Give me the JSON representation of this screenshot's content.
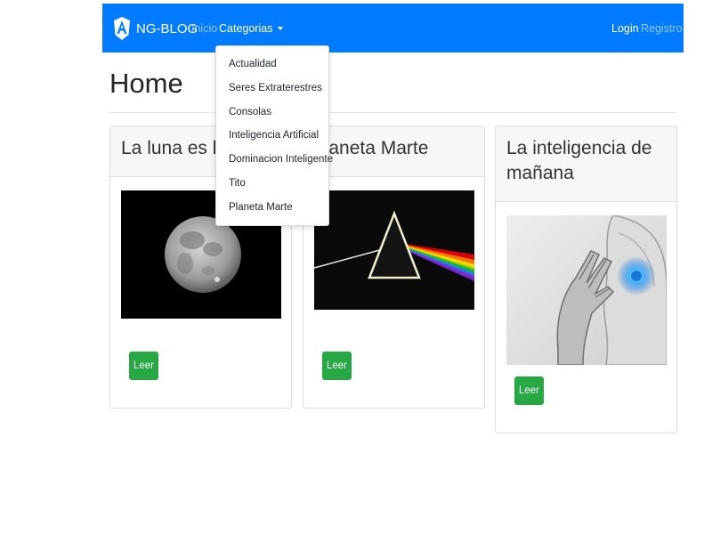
{
  "navbar": {
    "brand": "NG-BLOG",
    "links": {
      "inicio": "Inicio",
      "categorias": "Categorias",
      "login": "Login",
      "registro": "Registro"
    },
    "color": "#007bff"
  },
  "page": {
    "title": "Home"
  },
  "dropdown": {
    "items": [
      "Actualidad",
      "Seres Extraterestres",
      "Consolas",
      "Inteligencia Artificial",
      "Dominacion Inteligente",
      "Tito",
      "Planeta Marte"
    ]
  },
  "posts": [
    {
      "title": "La luna es bon",
      "image": "moon-image",
      "button": "Leer"
    },
    {
      "title": "planeta Marte",
      "image": "prism-image",
      "button": "Leer"
    },
    {
      "title": "La inteligencia de mañana",
      "image": "robot-image",
      "button": "Leer"
    }
  ],
  "colors": {
    "button": "#28a745",
    "link_muted": "rgba(255,255,255,0.55)"
  }
}
